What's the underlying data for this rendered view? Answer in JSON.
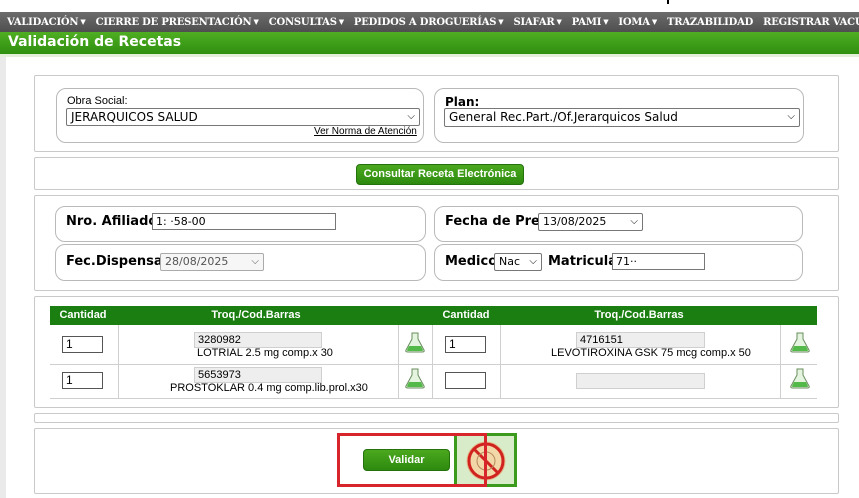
{
  "menu": {
    "items": [
      {
        "label": "VALIDACIÓN",
        "has_dropdown": true
      },
      {
        "label": "CIERRE DE PRESENTACIÓN",
        "has_dropdown": true
      },
      {
        "label": "CONSULTAS",
        "has_dropdown": true
      },
      {
        "label": "PEDIDOS A DROGUERÍAS",
        "has_dropdown": true
      },
      {
        "label": "SIAFAR",
        "has_dropdown": true
      },
      {
        "label": "PAMI",
        "has_dropdown": true
      },
      {
        "label": "IOMA",
        "has_dropdown": true
      },
      {
        "label": "TRAZABILIDAD",
        "has_dropdown": false
      },
      {
        "label": "REGISTRAR VACUNACION",
        "has_dropdown": false
      }
    ]
  },
  "page": {
    "title": "Validación de Recetas"
  },
  "obra": {
    "label": "Obra Social:",
    "value": "JERARQUICOS SALUD",
    "norma_link": "Ver Norma de Atención"
  },
  "plan": {
    "label": "Plan:",
    "value": "General Rec.Part./Of.Jerarquicos Salud"
  },
  "receta": {
    "consultar_label": "Consultar Receta Electrónica"
  },
  "afiliado": {
    "label": "Nro. Afiliado",
    "value": "1:  ·58-00"
  },
  "fecha_pres": {
    "label": "Fecha de Pres",
    "value": "13/08/2025"
  },
  "fec_dispensa": {
    "label": "Fec.Dispensa:",
    "value": "28/08/2025"
  },
  "medico": {
    "label": "Medico",
    "value": "Nac",
    "matricula_label": "Matricula",
    "matricula_value": "71··"
  },
  "table": {
    "headers": {
      "cantidad": "Cantidad",
      "troq": "Troq./Cod.Barras"
    },
    "rows": [
      {
        "left": {
          "qty": "1",
          "code": "3280982",
          "desc": "LOTRIAL 2.5 mg comp.x 30"
        },
        "right": {
          "qty": "1",
          "code": "4716151",
          "desc": "LEVOTIROXINA GSK 75 mcg comp.x 50"
        }
      },
      {
        "left": {
          "qty": "1",
          "code": "5653973",
          "desc": "PROSTOKLAR 0.4 mg comp.lib.prol.x30"
        },
        "right": {
          "qty": "",
          "code": "",
          "desc": ""
        }
      }
    ]
  },
  "actions": {
    "validar_label": "Validar"
  },
  "colors": {
    "menu_bg": "#5a5a5a",
    "title_green": "#3a9d16",
    "table_header": "#1a7f10",
    "highlight_red": "#d8252b"
  }
}
